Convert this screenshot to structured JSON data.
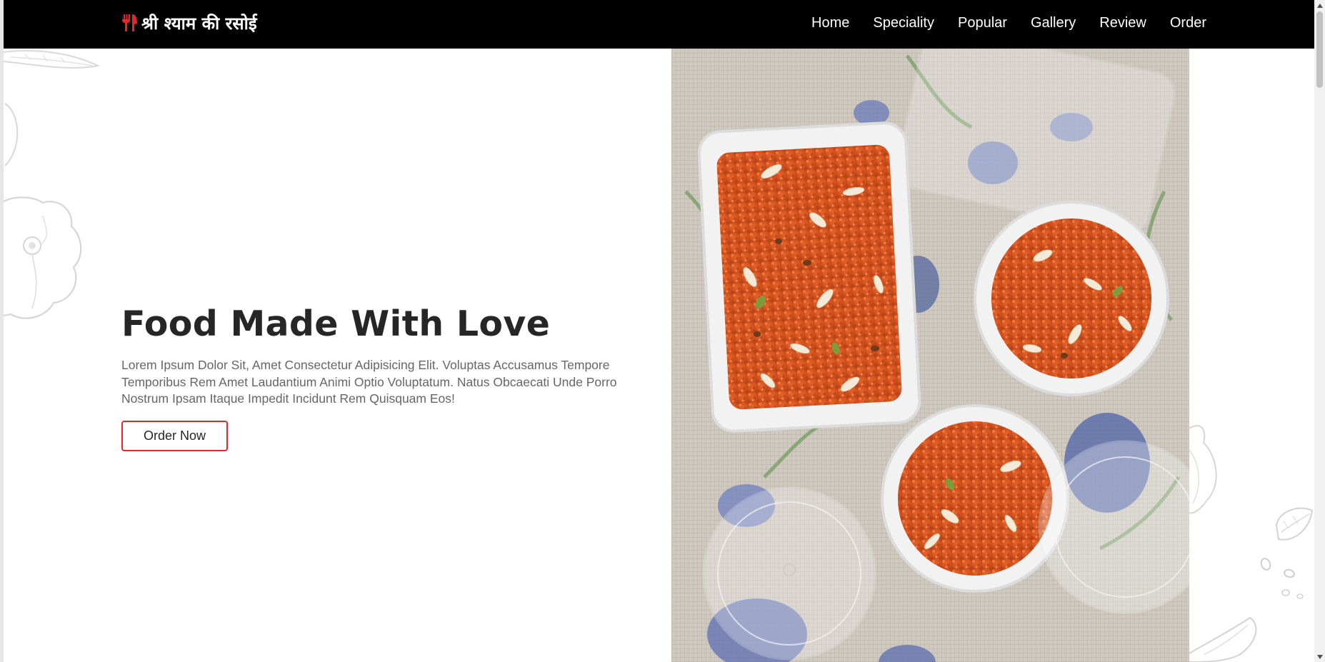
{
  "brand": {
    "name": "श्री श्याम की रसोई",
    "icon": "utensils-icon",
    "accent_color": "#e5262b"
  },
  "nav": {
    "items": [
      {
        "label": "Home"
      },
      {
        "label": "Speciality"
      },
      {
        "label": "Popular"
      },
      {
        "label": "Gallery"
      },
      {
        "label": "Review"
      },
      {
        "label": "Order"
      }
    ]
  },
  "hero": {
    "title": "Food Made With Love",
    "text": "Lorem Ipsum Dolor Sit, Amet Consectetur Adipisicing Elit. Voluptas Accusamus Tempore Temporibus Rem Amet Laudantium Animi Optio Voluptatum. Natus Obcaecati Unde Porro Nostrum Ipsam Itaque Impedit Incidunt Rem Quisquam Eos!",
    "button_label": "Order Now",
    "image": "gajar-halwa-photo"
  },
  "colors": {
    "navbar_bg": "#000000",
    "title_color": "#262626",
    "text_color": "#666666",
    "button_border": "#e5262b"
  }
}
